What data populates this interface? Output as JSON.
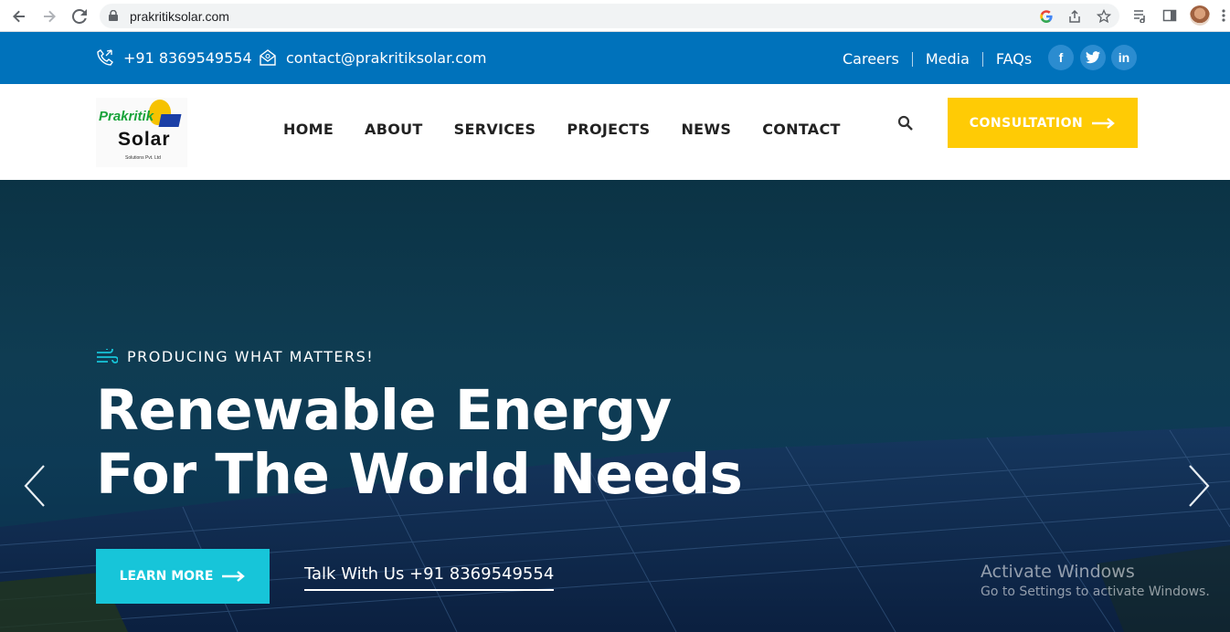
{
  "browser": {
    "url": "prakritiksolar.com",
    "icons": [
      "back-icon",
      "forward-icon",
      "reload-icon",
      "lock-icon",
      "google-icon",
      "share-icon",
      "star-icon",
      "reading-list-icon",
      "side-panel-icon",
      "avatar",
      "more-icon"
    ]
  },
  "topbar": {
    "phone": "+91 8369549554",
    "email": "contact@prakritiksolar.com",
    "links": [
      "Careers",
      "Media",
      "FAQs"
    ],
    "social": [
      "f",
      "t",
      "in"
    ],
    "color": "#0072bb"
  },
  "header": {
    "logo": {
      "line1": "Prakritik",
      "line2": "Solar",
      "line3": "Solutions Pvt. Ltd"
    },
    "menu": [
      "HOME",
      "ABOUT",
      "SERVICES",
      "PROJECTS",
      "NEWS",
      "CONTACT"
    ],
    "cta_label": "CONSULTATION",
    "cta_color": "#ffcb05"
  },
  "hero": {
    "eyebrow": "PRODUCING WHAT MATTERS!",
    "headline_line1": "Renewable Energy",
    "headline_line2": "For The World Needs",
    "learn_more": "LEARN MORE",
    "talk": "Talk With Us +91 8369549554",
    "accent_color": "#17c5d9"
  },
  "watermark": {
    "line1": "Activate Windows",
    "line2": "Go to Settings to activate Windows."
  }
}
